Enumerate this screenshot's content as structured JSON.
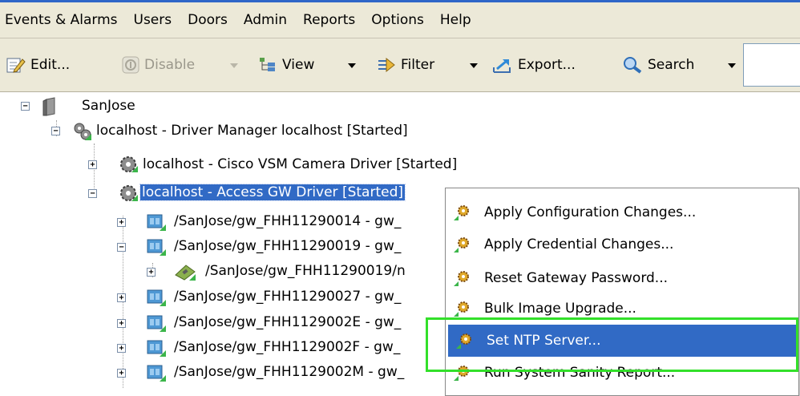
{
  "menubar": {
    "items": [
      "Events & Alarms",
      "Users",
      "Doors",
      "Admin",
      "Reports",
      "Options",
      "Help"
    ]
  },
  "toolbar": {
    "edit_label": "Edit...",
    "disable_label": "Disable",
    "view_label": "View",
    "filter_label": "Filter",
    "export_label": "Export...",
    "search_label": "Search"
  },
  "tree": {
    "root": "SanJose",
    "driver_manager": "localhost - Driver Manager localhost [Started]",
    "vsm_driver": "localhost - Cisco VSM Camera Driver [Started]",
    "access_driver": "localhost - Access GW Driver [Started]",
    "gateways": [
      "/SanJose/gw_FHH11290014 - gw_",
      "/SanJose/gw_FHH11290019 - gw_",
      "/SanJose/gw_FHH11290019/n",
      "/SanJose/gw_FHH11290027 - gw_",
      "/SanJose/gw_FHH1129002E - gw_",
      "/SanJose/gw_FHH1129002F - gw_",
      "/SanJose/gw_FHH1129002M - gw_"
    ]
  },
  "context_menu": {
    "items": [
      "Apply Configuration Changes...",
      "Apply Credential Changes...",
      "Reset Gateway Password...",
      "Bulk Image Upgrade...",
      "Set NTP Server...",
      "Run System Sanity Report..."
    ],
    "highlighted_index": 4
  },
  "colors": {
    "selection": "#316ac5",
    "annotation_box": "#33e02a",
    "chrome": "#ece9d8"
  }
}
